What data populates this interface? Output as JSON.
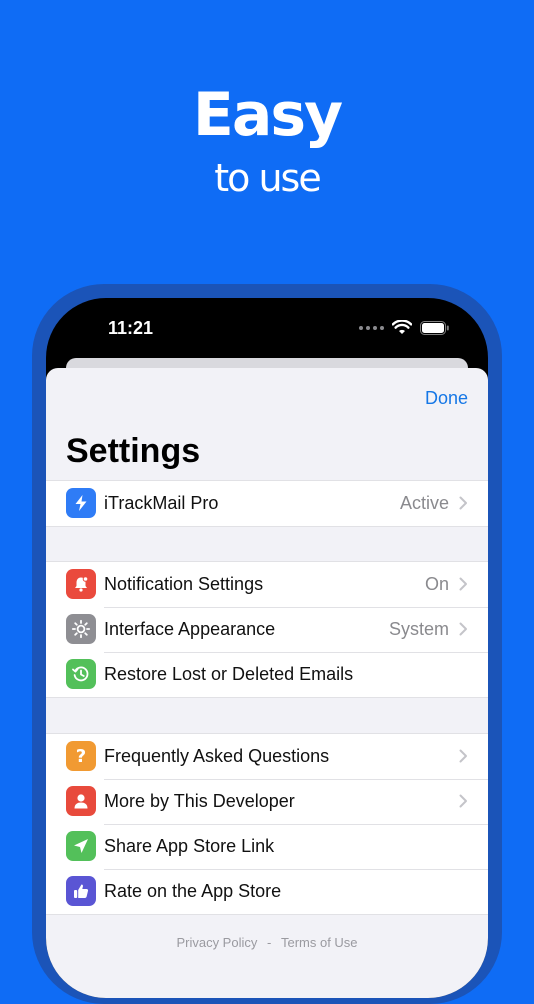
{
  "hero": {
    "title": "Easy",
    "subtitle": "to use"
  },
  "status_bar": {
    "time": "11:21"
  },
  "header": {
    "done_label": "Done",
    "title": "Settings"
  },
  "groups": [
    {
      "rows": [
        {
          "label": "iTrackMail Pro",
          "value": "Active",
          "icon": "bolt-icon",
          "color": "#2F7CF6",
          "chevron": true
        }
      ]
    },
    {
      "rows": [
        {
          "label": "Notification Settings",
          "value": "On",
          "icon": "bell-icon",
          "color": "#EA4A3D",
          "chevron": true
        },
        {
          "label": "Interface Appearance",
          "value": "System",
          "icon": "gear-icon",
          "color": "#8E8E93",
          "chevron": true
        },
        {
          "label": "Restore Lost or Deleted Emails",
          "value": "",
          "icon": "history-icon",
          "color": "#53C05A",
          "chevron": false
        }
      ]
    },
    {
      "rows": [
        {
          "label": "Frequently Asked Questions",
          "value": "",
          "icon": "question-icon",
          "color": "#F19A32",
          "chevron": true
        },
        {
          "label": "More by This Developer",
          "value": "",
          "icon": "person-icon",
          "color": "#E84A3C",
          "chevron": true
        },
        {
          "label": "Share App Store Link",
          "value": "",
          "icon": "paperplane-icon",
          "color": "#53C05A",
          "chevron": false
        },
        {
          "label": "Rate on the App Store",
          "value": "",
          "icon": "thumbsup-icon",
          "color": "#5A55D4",
          "chevron": false
        }
      ]
    }
  ],
  "footer": {
    "privacy_policy": "Privacy Policy",
    "separator": "-",
    "terms_of_use": "Terms of Use"
  }
}
